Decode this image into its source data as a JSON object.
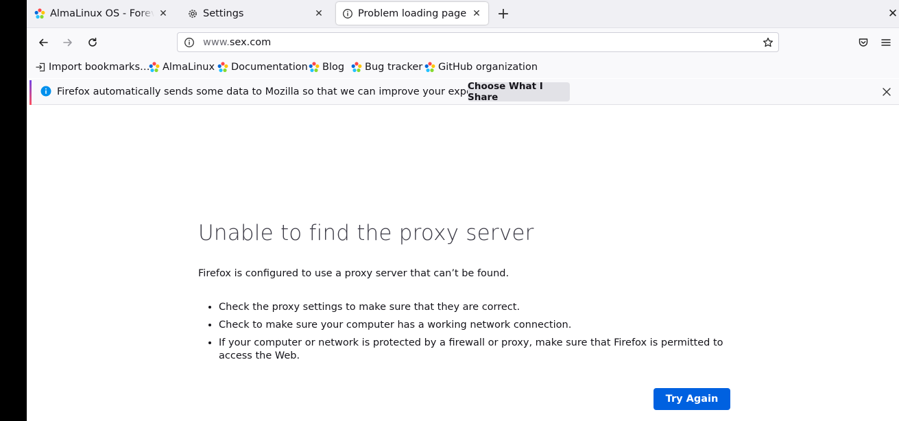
{
  "tabs": [
    {
      "label": "AlmaLinux OS - Forever-Free Enterprise OS",
      "icon": "almalinux-logo-icon",
      "active": false
    },
    {
      "label": "Settings",
      "icon": "gear-icon",
      "active": false
    },
    {
      "label": "Problem loading page",
      "icon": "info-icon",
      "active": true
    }
  ],
  "navbar": {
    "url_prefix": "www.",
    "url_host": "sex.com"
  },
  "bookmarks": [
    {
      "label": "Import bookmarks…",
      "icon": "import-icon"
    },
    {
      "label": "AlmaLinux",
      "icon": "almalinux-logo-icon"
    },
    {
      "label": "Documentation",
      "icon": "almalinux-logo-icon"
    },
    {
      "label": "Blog",
      "icon": "almalinux-logo-icon"
    },
    {
      "label": "Bug tracker",
      "icon": "almalinux-logo-icon"
    },
    {
      "label": "GitHub organization",
      "icon": "almalinux-logo-icon"
    }
  ],
  "notification": {
    "message": "Firefox automatically sends some data to Mozilla so that we can improve your experience.",
    "button": "Choose What I Share"
  },
  "error": {
    "title": "Unable to find the proxy server",
    "description": "Firefox is configured to use a proxy server that can’t be found.",
    "items": [
      "Check the proxy settings to make sure that they are correct.",
      "Check to make sure your computer has a working network connection.",
      "If your computer or network is protected by a firewall or proxy, make sure that Firefox is permitted to access the Web."
    ],
    "button": "Try Again"
  },
  "colors": {
    "accent_blue": "#0061e0",
    "notification_gradient_start": "#7542e5",
    "notification_gradient_end": "#ff4f5e"
  }
}
